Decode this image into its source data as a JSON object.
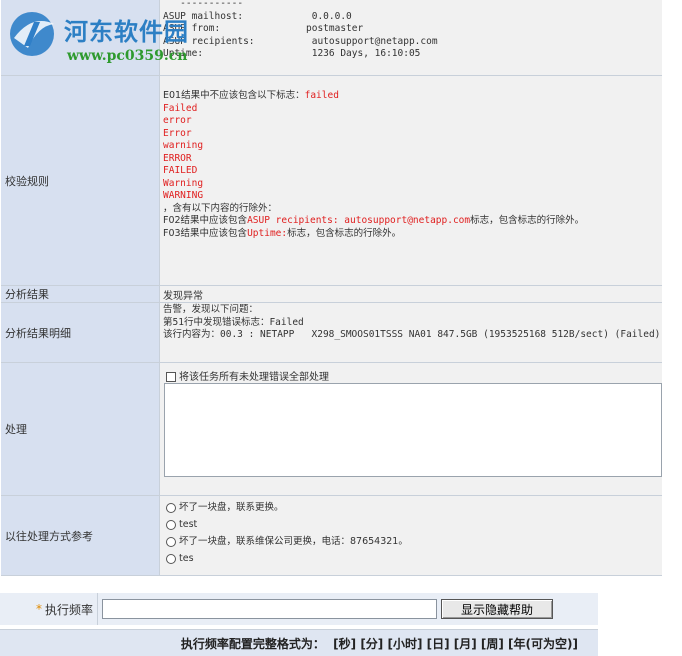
{
  "logo": {
    "title": "河东软件园",
    "url": "www.pc0359.cn"
  },
  "top_block": {
    "lines": [
      {
        "key": "ASUP mailhost:",
        "value": "0.0.0.0"
      },
      {
        "key": "ASUP from:",
        "value": "postmaster"
      },
      {
        "key": "ASUP recipients:",
        "value": "autosupport@netapp.com"
      },
      {
        "key": "Uptime:",
        "value": "1236 Days, 16:10:05"
      }
    ]
  },
  "rules": {
    "label": "校验规则",
    "e01_prefix": "E01结果中不应该包含以下标志：",
    "e01_first": "failed",
    "flags": [
      "Failed",
      "error",
      "Error",
      "warning",
      "ERROR",
      "FAILED",
      "Warning",
      "WARNING"
    ],
    "exclude_note": "，含有以下内容的行除外：",
    "f02_prefix": "F02结果中应该包含",
    "f02_value": "ASUP recipients: autosupport@netapp.com",
    "f02_suffix": "标志，包含标志的行除外。",
    "f03_prefix": "F03结果中应该包含",
    "f03_value": "Uptime:",
    "f03_suffix": "标志，包含标志的行除外。"
  },
  "analysis": {
    "label": "分析结果",
    "value": "发现异常"
  },
  "detail": {
    "label": "分析结果明细",
    "line1": "告警，发现以下问题：",
    "line2": "第51行中发现错误标志：Failed",
    "line3": "该行内容为：00.3 : NETAPP   X298_SMOOS01TSSS NA01 847.5GB (1953525168 512B/sect) (Failed)"
  },
  "handle": {
    "label": "处理",
    "checkbox_label": "将该任务所有未处理错误全部处理"
  },
  "history": {
    "label": "以往处理方式参考",
    "options": [
      "坏了一块盘，联系更换。",
      "test",
      "坏了一块盘，联系维保公司更换，电话：87654321。",
      "tes"
    ]
  },
  "frequency": {
    "star": "*",
    "label": "执行频率",
    "value": "",
    "help_button": "显示隐藏帮助",
    "format_text": "执行频率配置完整格式为：  [秒] [分] [小时] [日] [月] [周] [年(可为空)]"
  }
}
